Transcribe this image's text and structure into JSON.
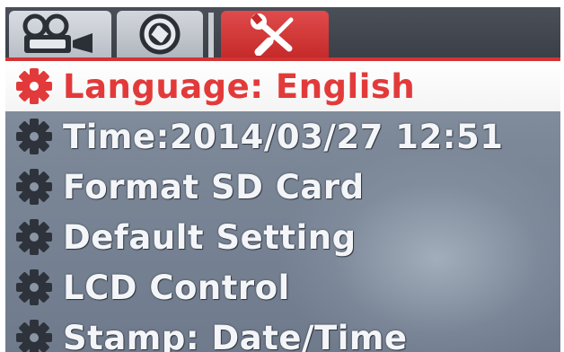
{
  "tabs": [
    {
      "name": "video",
      "icon": "video-camera-icon",
      "active": false
    },
    {
      "name": "photo",
      "icon": "camera-lens-icon",
      "active": false
    },
    {
      "name": "setup",
      "icon": "tools-icon",
      "active": true
    }
  ],
  "menu": {
    "items": [
      {
        "label": "Language: English",
        "selected": true
      },
      {
        "label": "Time:2014/03/27 12:51",
        "selected": false
      },
      {
        "label": "Format SD Card",
        "selected": false
      },
      {
        "label": "Default Setting",
        "selected": false
      },
      {
        "label": "LCD Control",
        "selected": false
      },
      {
        "label": "Stamp: Date/Time",
        "selected": false
      }
    ]
  },
  "colors": {
    "accent": "#e23a3a",
    "menu_bg": "#7c8898",
    "text": "#f3f5f8"
  }
}
